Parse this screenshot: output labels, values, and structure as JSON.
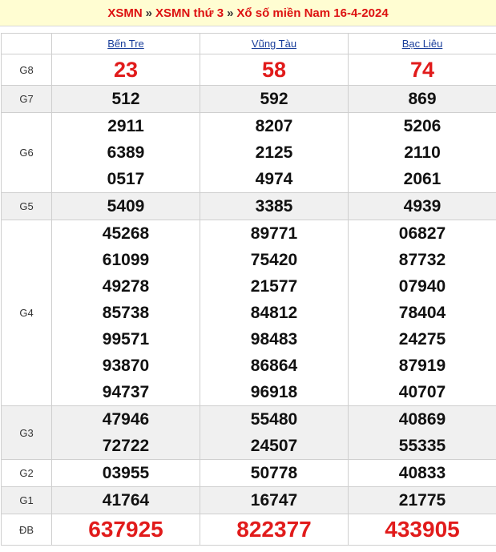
{
  "breadcrumb": {
    "home": "XSMN",
    "separator": "»",
    "day": "XSMN thứ 3",
    "current": "Xổ số miền Nam 16-4-2024"
  },
  "colors": {
    "header_bg": "#fffdd2",
    "highlight_red": "#e11b1b",
    "province_link": "#1a3e9b",
    "alt_row": "#f0f0f0"
  },
  "provinces": [
    "Bến Tre",
    "Vũng Tàu",
    "Bạc Liêu"
  ],
  "prizes": [
    {
      "label": "G8",
      "style": "big",
      "alt": false,
      "values": [
        [
          "23"
        ],
        [
          "58"
        ],
        [
          "74"
        ]
      ]
    },
    {
      "label": "G7",
      "style": "normal",
      "alt": true,
      "values": [
        [
          "512"
        ],
        [
          "592"
        ],
        [
          "869"
        ]
      ]
    },
    {
      "label": "G6",
      "style": "normal",
      "alt": false,
      "values": [
        [
          "2911",
          "6389",
          "0517"
        ],
        [
          "8207",
          "2125",
          "4974"
        ],
        [
          "5206",
          "2110",
          "2061"
        ]
      ]
    },
    {
      "label": "G5",
      "style": "normal",
      "alt": true,
      "values": [
        [
          "5409"
        ],
        [
          "3385"
        ],
        [
          "4939"
        ]
      ]
    },
    {
      "label": "G4",
      "style": "normal",
      "alt": false,
      "values": [
        [
          "45268",
          "61099",
          "49278",
          "85738",
          "99571",
          "93870",
          "94737"
        ],
        [
          "89771",
          "75420",
          "21577",
          "84812",
          "98483",
          "86864",
          "96918"
        ],
        [
          "06827",
          "87732",
          "07940",
          "78404",
          "24275",
          "87919",
          "40707"
        ]
      ]
    },
    {
      "label": "G3",
      "style": "normal",
      "alt": true,
      "values": [
        [
          "47946",
          "72722"
        ],
        [
          "55480",
          "24507"
        ],
        [
          "40869",
          "55335"
        ]
      ]
    },
    {
      "label": "G2",
      "style": "normal",
      "alt": false,
      "values": [
        [
          "03955"
        ],
        [
          "50778"
        ],
        [
          "40833"
        ]
      ]
    },
    {
      "label": "G1",
      "style": "normal",
      "alt": true,
      "values": [
        [
          "41764"
        ],
        [
          "16747"
        ],
        [
          "21775"
        ]
      ]
    },
    {
      "label": "ĐB",
      "style": "jackpot",
      "alt": false,
      "values": [
        [
          "637925"
        ],
        [
          "822377"
        ],
        [
          "433905"
        ]
      ]
    }
  ]
}
